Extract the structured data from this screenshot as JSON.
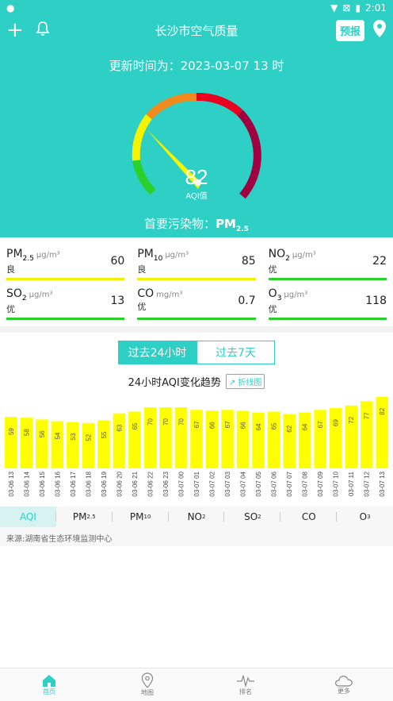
{
  "status": {
    "time": "2:01"
  },
  "header": {
    "title": "长沙市空气质量",
    "forecast_label": "预报"
  },
  "hero": {
    "update_text": "更新时间为：2023-03-07 13 时",
    "aqi_value": "82",
    "aqi_label": "AQI值",
    "primary_label": "首要污染物：",
    "primary_value": "PM",
    "primary_sub": "2.5"
  },
  "pollutants": [
    {
      "name": "PM",
      "sub": "2.5",
      "unit": "μg/m³",
      "level": "良",
      "value": "60",
      "color": "#f0f000"
    },
    {
      "name": "PM",
      "sub": "10",
      "unit": "μg/m³",
      "level": "良",
      "value": "85",
      "color": "#f0f000"
    },
    {
      "name": "NO",
      "sub": "2",
      "unit": "μg/m³",
      "level": "优",
      "value": "22",
      "color": "#2bd12b"
    },
    {
      "name": "SO",
      "sub": "2",
      "unit": "μg/m³",
      "level": "优",
      "value": "13",
      "color": "#2bd12b"
    },
    {
      "name": "CO",
      "sub": "",
      "unit": "mg/m³",
      "level": "优",
      "value": "0.7",
      "color": "#2bd12b"
    },
    {
      "name": "O",
      "sub": "3",
      "unit": "μg/m³",
      "level": "优",
      "value": "118",
      "color": "#2bd12b"
    }
  ],
  "tabs": {
    "day": "过去24小时",
    "week": "过去7天"
  },
  "trend": {
    "title": "24小时AQI变化趋势",
    "line_button": "折线图"
  },
  "chart_data": {
    "type": "bar",
    "categories": [
      "03-06 13",
      "03-06 14",
      "03-06 15",
      "03-06 16",
      "03-06 17",
      "03-06 18",
      "03-06 19",
      "03-06 20",
      "03-06 21",
      "03-06 22",
      "03-06 23",
      "03-07 00",
      "03-07 01",
      "03-07 02",
      "03-07 03",
      "03-07 04",
      "03-07 05",
      "03-07 06",
      "03-07 07",
      "03-07 08",
      "03-07 09",
      "03-07 10",
      "03-07 11",
      "03-07 12",
      "03-07 13"
    ],
    "values": [
      59,
      58,
      56,
      54,
      53,
      52,
      55,
      63,
      65,
      70,
      70,
      70,
      67,
      66,
      67,
      66,
      64,
      65,
      62,
      64,
      67,
      69,
      72,
      77,
      82
    ],
    "bar_color": "#ffff00"
  },
  "metric_tabs": [
    {
      "name": "AQI",
      "sub": ""
    },
    {
      "name": "PM",
      "sub": "2.5"
    },
    {
      "name": "PM",
      "sub": "10"
    },
    {
      "name": "NO",
      "sub": "2"
    },
    {
      "name": "SO",
      "sub": "2"
    },
    {
      "name": "CO",
      "sub": ""
    },
    {
      "name": "O",
      "sub": "3"
    }
  ],
  "source": "来源:湖南省生态环境监测中心",
  "nav": {
    "home": "首页",
    "map": "地图",
    "rank": "排名",
    "more": "更多"
  },
  "colors": {
    "accent": "#2ecfc4"
  }
}
